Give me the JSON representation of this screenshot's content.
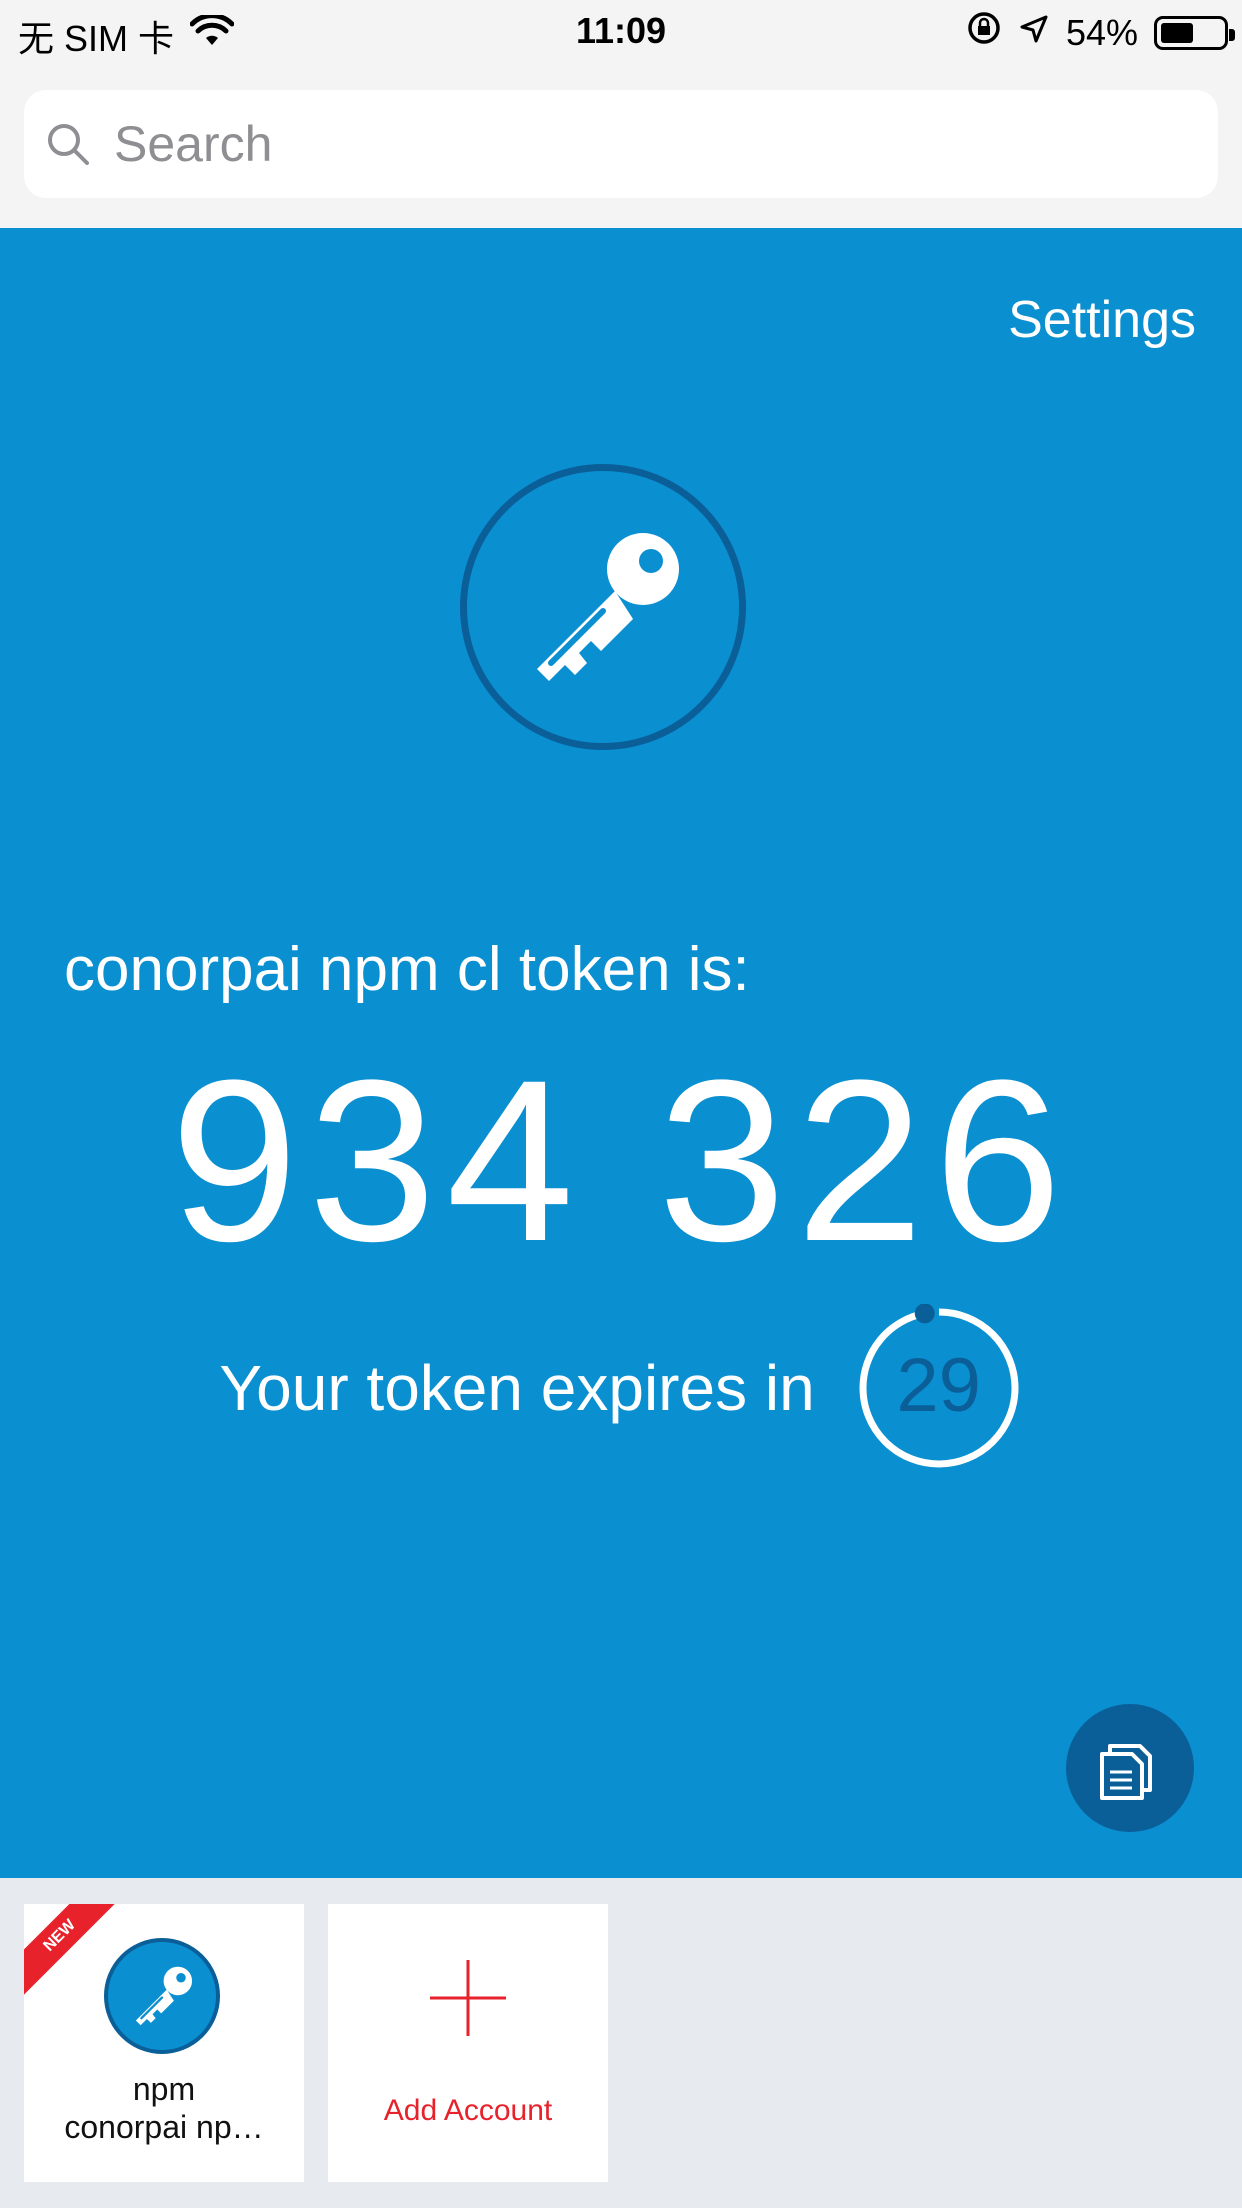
{
  "status_bar": {
    "carrier": "无 SIM 卡",
    "time": "11:09",
    "battery_percent": "54%",
    "battery_level": 0.54,
    "icons": [
      "wifi-icon",
      "rotation-lock-icon",
      "location-icon",
      "battery-icon"
    ]
  },
  "search": {
    "placeholder": "Search"
  },
  "header": {
    "settings_label": "Settings"
  },
  "token": {
    "label": "conorpai npm cl token is:",
    "code": "934 326",
    "expires_text": "Your token expires in",
    "seconds_remaining": "29",
    "countdown_fraction": 0.97
  },
  "accounts": [
    {
      "badge": "NEW",
      "name": "npm",
      "subtitle": "conorpai np…",
      "icon": "key-icon"
    }
  ],
  "add_account": {
    "label": "Add Account",
    "icon": "plus-icon"
  },
  "colors": {
    "primary": "#0a8fd0",
    "dark": "#0b5f99",
    "accent_red": "#e8222b",
    "background": "#f4f4f4",
    "grid_background": "#e7ebef"
  }
}
